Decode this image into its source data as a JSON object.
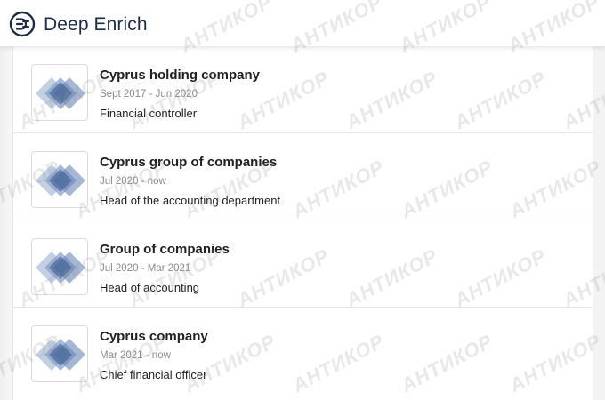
{
  "header": {
    "app_title": "Deep Enrich",
    "logo_icon": "deep-enrich-logo-icon"
  },
  "experience": [
    {
      "company": "Cyprus holding company",
      "period": "Sept 2017 - Jun 2020",
      "role": "Financial controller",
      "logo_icon": "diamond-logo-icon"
    },
    {
      "company": "Cyprus group of companies",
      "period": "Jul 2020 - now",
      "role": "Head of the accounting department",
      "logo_icon": "diamond-logo-icon"
    },
    {
      "company": "Group of companies",
      "period": "Jul 2020 - Mar 2021",
      "role": "Head of accounting",
      "logo_icon": "diamond-logo-icon"
    },
    {
      "company": "Cyprus company",
      "period": "Mar 2021 - now",
      "role": "Chief financial officer",
      "logo_icon": "diamond-logo-icon"
    }
  ],
  "watermark": {
    "text": "АНТИКОР"
  },
  "colors": {
    "brand": "#1f2c44",
    "muted": "#8b8b8b",
    "diamond": "#4a6a9c"
  }
}
